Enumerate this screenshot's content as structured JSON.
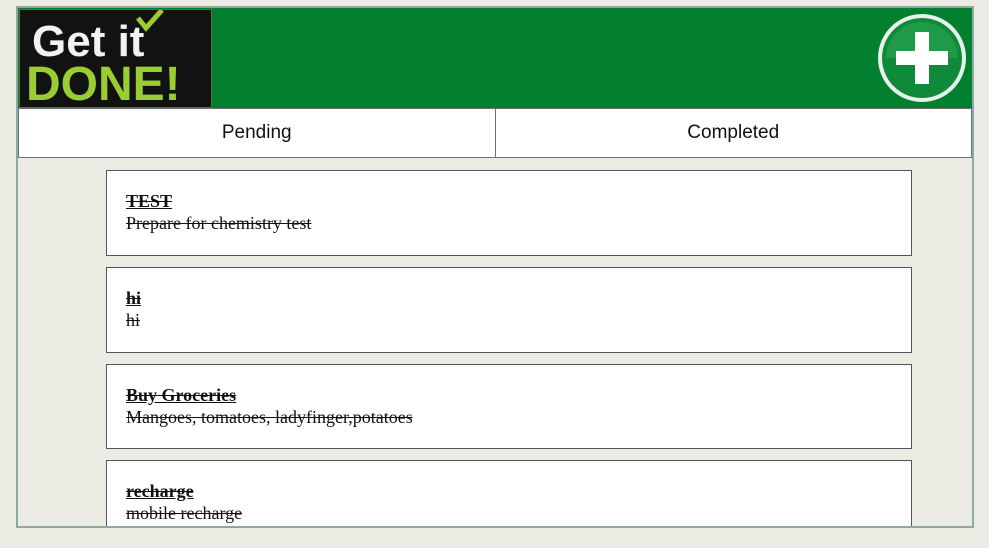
{
  "app": {
    "logo_text_top": "Get it",
    "logo_text_bottom": "DONE!",
    "header_color": "#028030"
  },
  "header": {
    "add_icon": "plus-circle-icon"
  },
  "tabs": [
    {
      "label": "Pending"
    },
    {
      "label": "Completed"
    }
  ],
  "tasks": [
    {
      "title": "TEST",
      "description": "Prepare for chemistry test"
    },
    {
      "title": "hi",
      "description": "hi"
    },
    {
      "title": "Buy Groceries",
      "description": "Mangoes, tomatoes, ladyfinger,potatoes"
    },
    {
      "title": "recharge",
      "description": "mobile recharge"
    }
  ]
}
